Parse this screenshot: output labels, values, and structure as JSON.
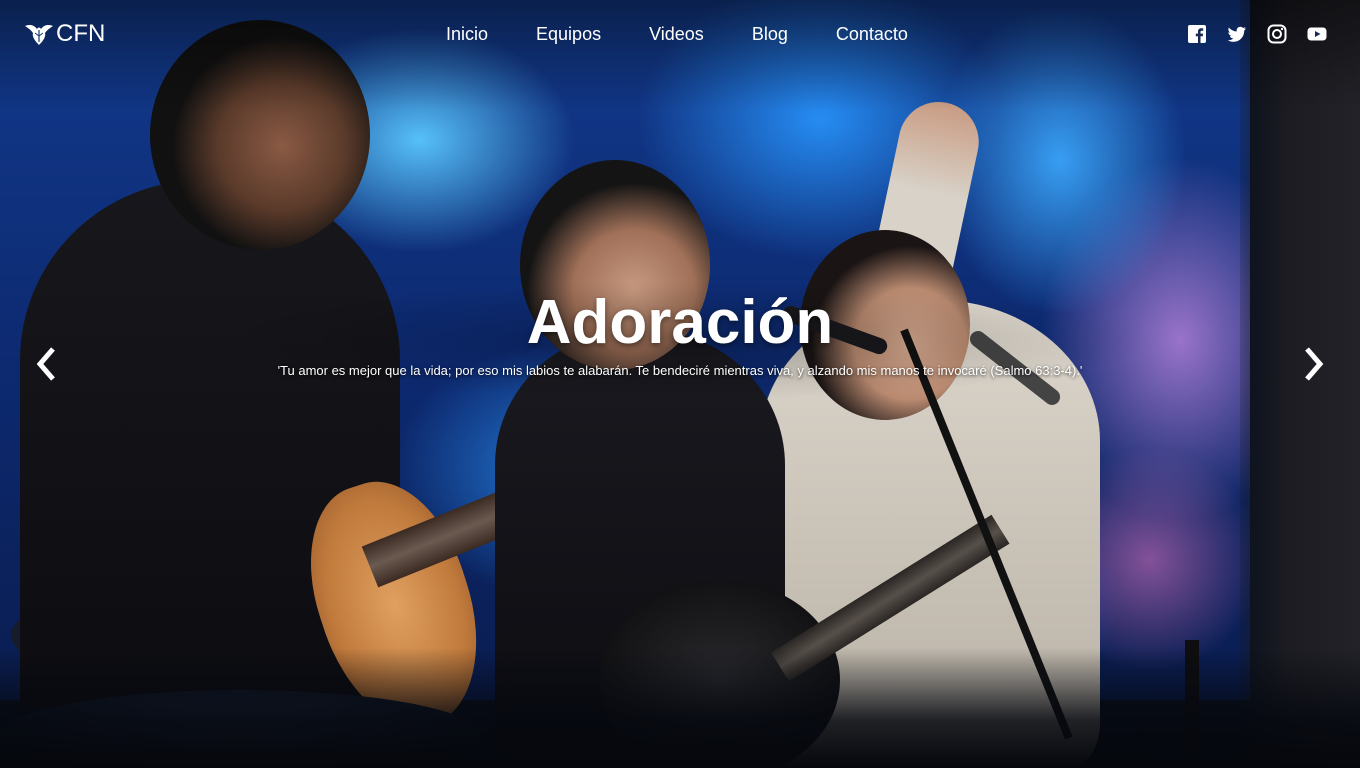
{
  "brand": {
    "logo_text": "CFN",
    "logo_icon": "eagle-icon"
  },
  "nav": {
    "items": [
      {
        "label": "Inicio"
      },
      {
        "label": "Equipos"
      },
      {
        "label": "Videos"
      },
      {
        "label": "Blog"
      },
      {
        "label": "Contacto"
      }
    ]
  },
  "social": {
    "items": [
      {
        "icon": "facebook-icon"
      },
      {
        "icon": "twitter-icon"
      },
      {
        "icon": "instagram-icon"
      },
      {
        "icon": "youtube-icon"
      }
    ]
  },
  "hero": {
    "title": "Adoración",
    "text": "'Tu amor es mejor que la vida; por eso mis labios te alabarán. Te bendeciré mientras viva, y alzando mis manos te invocaré (Salmo 63:3-4).'",
    "prev_icon": "chevron-left-icon",
    "next_icon": "chevron-right-icon"
  },
  "colors": {
    "text": "#ffffff",
    "screen_blue": "#1e6fe0",
    "screen_purple": "#c88ce6"
  }
}
